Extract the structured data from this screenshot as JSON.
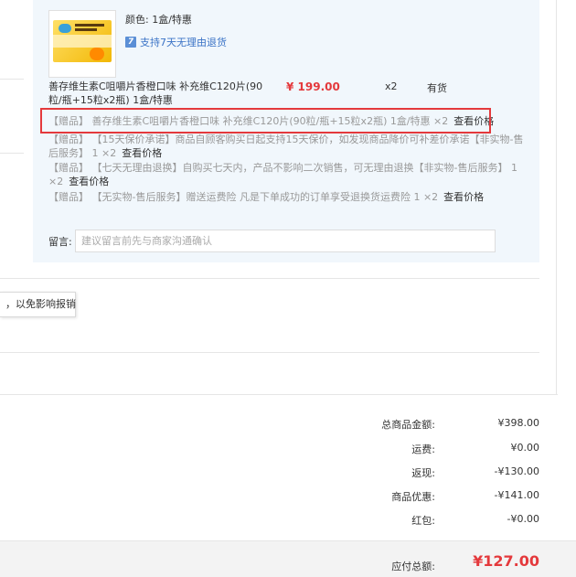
{
  "product": {
    "spec": "颜色: 1盒/特惠",
    "return_policy": "支持7天无理由退货",
    "return_icon": "7",
    "title": "善存维生素C咀嚼片香橙口味 补充维C120片(90粒/瓶+15粒x2瓶) 1盒/特惠",
    "price": "¥ 199.00",
    "qty": "x2",
    "stock": "有货"
  },
  "gifts": [
    {
      "tag": "【赠品】",
      "text": "  善存维生素C咀嚼片香橙口味 补充维C120片(90粒/瓶+15粒x2瓶) 1盒/特惠 ×2",
      "link": "查看价格"
    },
    {
      "tag": "【赠品】",
      "text": "  【15天保价承诺】商品自顾客购买日起支持15天保价，如发现商品降价可补差价承诺【非实物-售后服务】 1 ×2",
      "link": "查看价格"
    },
    {
      "tag": "【赠品】",
      "text": "  【七天无理由退换】自购买七天内，产品不影响二次销售，可无理由退换【非实物-售后服务】 1 ×2",
      "link": "查看价格"
    },
    {
      "tag": "【赠品】",
      "text": "  【无实物-售后服务】赠送运费险 凡是下单成功的订单享受退换货运费险 1 ×2",
      "link": "查看价格"
    }
  ],
  "message": {
    "label": "留言:",
    "placeholder": "建议留言前先与商家沟通确认"
  },
  "tooltip": "，以免影响报销",
  "summary": [
    {
      "label": "总商品金额:",
      "value": "¥398.00"
    },
    {
      "label": "运费:",
      "value": "¥0.00"
    },
    {
      "label": "返现:",
      "value": "-¥130.00"
    },
    {
      "label": "商品优惠:",
      "value": "-¥141.00"
    },
    {
      "label": "红包:",
      "value": "-¥0.00"
    }
  ],
  "total": {
    "label": "应付总额:",
    "value": "¥127.00"
  },
  "colors": {
    "accent_red": "#e4393c",
    "link_blue": "#3a73c6",
    "panel_bg": "#f1f7fc"
  }
}
